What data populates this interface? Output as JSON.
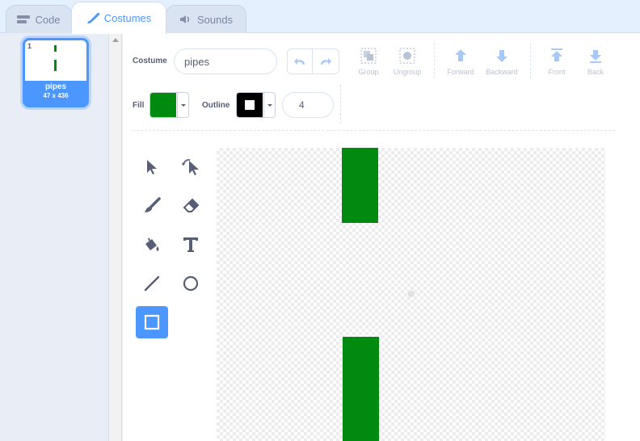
{
  "tabs": [
    {
      "label": "Code",
      "icon": "code-icon"
    },
    {
      "label": "Costumes",
      "icon": "brush-icon",
      "active": true
    },
    {
      "label": "Sounds",
      "icon": "speaker-icon"
    }
  ],
  "costume_list": {
    "items": [
      {
        "number": "1",
        "name": "pipes",
        "size": "47 x 436"
      }
    ]
  },
  "editor": {
    "costume_label": "Costume",
    "costume_name": "pipes",
    "toolbar": {
      "group": "Group",
      "ungroup": "Ungroup",
      "forward": "Forward",
      "backward": "Backward",
      "front": "Front",
      "back": "Back"
    },
    "fill_label": "Fill",
    "fill_color": "#008a0f",
    "outline_label": "Outline",
    "outline_color": "#000000",
    "outline_width": "4",
    "selected_tool": "rectangle-tool",
    "tools": [
      "select-tool",
      "reshape-tool",
      "brush-tool",
      "eraser-tool",
      "fill-tool",
      "text-tool",
      "line-tool",
      "circle-tool",
      "rectangle-tool"
    ]
  },
  "colors": {
    "accent": "#4c97ff",
    "pipe_green": "#008a0f",
    "text": "#575e75"
  }
}
